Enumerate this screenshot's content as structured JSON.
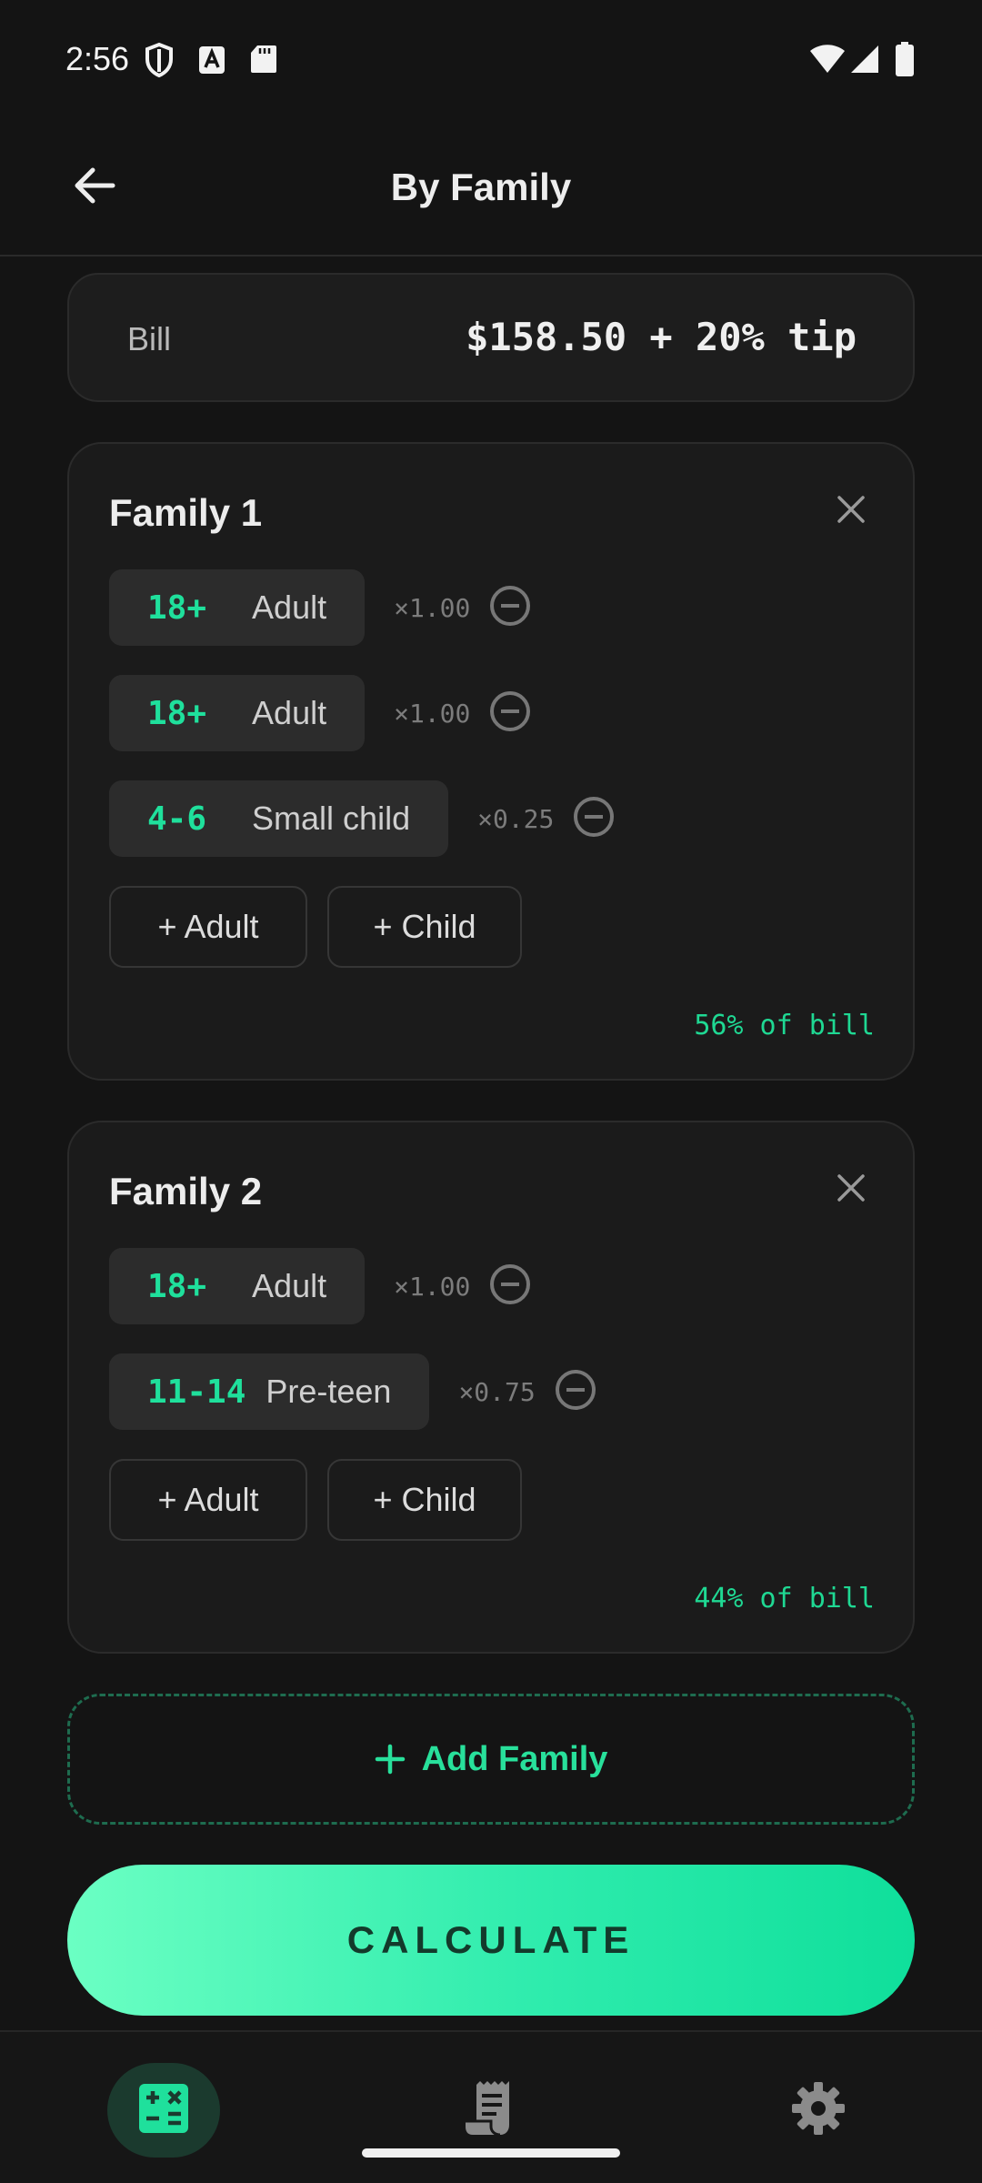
{
  "status_bar": {
    "time": "2:56",
    "icons": [
      "shield-icon",
      "a-badge-icon",
      "sd-card-icon",
      "wifi-icon",
      "signal-icon",
      "battery-icon"
    ]
  },
  "header": {
    "title": "By Family",
    "back_icon": "arrow-left-icon"
  },
  "bill": {
    "label": "Bill",
    "value": "$158.50 + 20% tip"
  },
  "families": [
    {
      "name": "Family 1",
      "members": [
        {
          "age": "18+",
          "kind": "Adult",
          "multiplier": "×1.00"
        },
        {
          "age": "18+",
          "kind": "Adult",
          "multiplier": "×1.00"
        },
        {
          "age": "4-6",
          "kind": "Small child",
          "multiplier": "×0.25"
        }
      ],
      "add_adult": "+ Adult",
      "add_child": "+ Child",
      "share": "56% of bill"
    },
    {
      "name": "Family 2",
      "members": [
        {
          "age": "18+",
          "kind": "Adult",
          "multiplier": "×1.00"
        },
        {
          "age": "11-14",
          "kind": "Pre-teen",
          "multiplier": "×0.75"
        }
      ],
      "add_adult": "+ Adult",
      "add_child": "+ Child",
      "share": "44% of bill"
    }
  ],
  "add_family_label": "Add Family",
  "calculate_label": "CALCULATE",
  "bottom_nav": [
    {
      "icon": "calculator-icon",
      "active": true
    },
    {
      "icon": "receipt-icon",
      "active": false
    },
    {
      "icon": "settings-icon",
      "active": false
    }
  ],
  "colors": {
    "accent": "#1fe09c",
    "background": "#141414",
    "card": "#1b1b1b",
    "chip": "#2c2c2c"
  }
}
